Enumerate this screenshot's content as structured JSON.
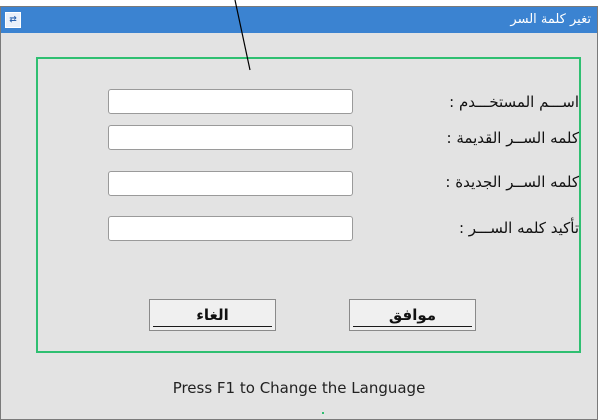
{
  "window": {
    "title": "تغير كلمة السر",
    "app_icon": "window-app-icon"
  },
  "form": {
    "fields": [
      {
        "label": "اســـم المستخـــدم :",
        "value": ""
      },
      {
        "label": "كلمه الســر القديمة :",
        "value": ""
      },
      {
        "label": "كلمه الســر الجديدة :",
        "value": ""
      },
      {
        "label": "تأكيد كلمه الســـر :",
        "value": ""
      }
    ],
    "ok_label": "موافق",
    "cancel_label": "الغاء"
  },
  "footer": {
    "hint": "Press F1 to Change the Language"
  },
  "colors": {
    "titlebar": "#3b83d1",
    "panel_border": "#2fbf71",
    "window_bg": "#e3e3e3"
  }
}
